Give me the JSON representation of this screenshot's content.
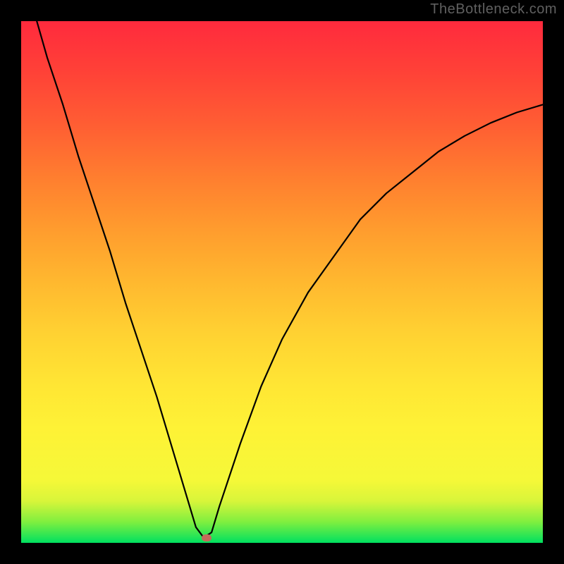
{
  "watermark": "TheBottleneck.com",
  "chart_data": {
    "type": "line",
    "title": "",
    "xlabel": "",
    "ylabel": "",
    "xlim": [
      0,
      100
    ],
    "ylim": [
      0,
      100
    ],
    "grid": false,
    "series": [
      {
        "name": "bottleneck-curve",
        "x": [
          3,
          5,
          8,
          11,
          14,
          17,
          20,
          23,
          26,
          29,
          32,
          33.5,
          35,
          36.5,
          38,
          42,
          46,
          50,
          55,
          60,
          65,
          70,
          75,
          80,
          85,
          90,
          95,
          100
        ],
        "y": [
          100,
          93,
          84,
          74,
          65,
          56,
          46,
          37,
          28,
          18,
          8,
          3,
          1,
          2,
          7,
          19,
          30,
          39,
          48,
          55,
          62,
          67,
          71,
          75,
          78,
          80.5,
          82.5,
          84
        ]
      }
    ],
    "min_point": {
      "x": 35.5,
      "y": 1
    },
    "background_gradient": {
      "type": "vertical",
      "stops": [
        {
          "pos": 0,
          "color": "#00e060"
        },
        {
          "pos": 4,
          "color": "#7fef3f"
        },
        {
          "pos": 8,
          "color": "#d8f53a"
        },
        {
          "pos": 12,
          "color": "#f5f838"
        },
        {
          "pos": 22,
          "color": "#fef236"
        },
        {
          "pos": 30,
          "color": "#ffe634"
        },
        {
          "pos": 40,
          "color": "#ffd232"
        },
        {
          "pos": 50,
          "color": "#ffb82f"
        },
        {
          "pos": 60,
          "color": "#ff9c2e"
        },
        {
          "pos": 70,
          "color": "#ff7e2f"
        },
        {
          "pos": 80,
          "color": "#ff5e33"
        },
        {
          "pos": 90,
          "color": "#ff4237"
        },
        {
          "pos": 100,
          "color": "#ff2a3d"
        }
      ]
    }
  }
}
